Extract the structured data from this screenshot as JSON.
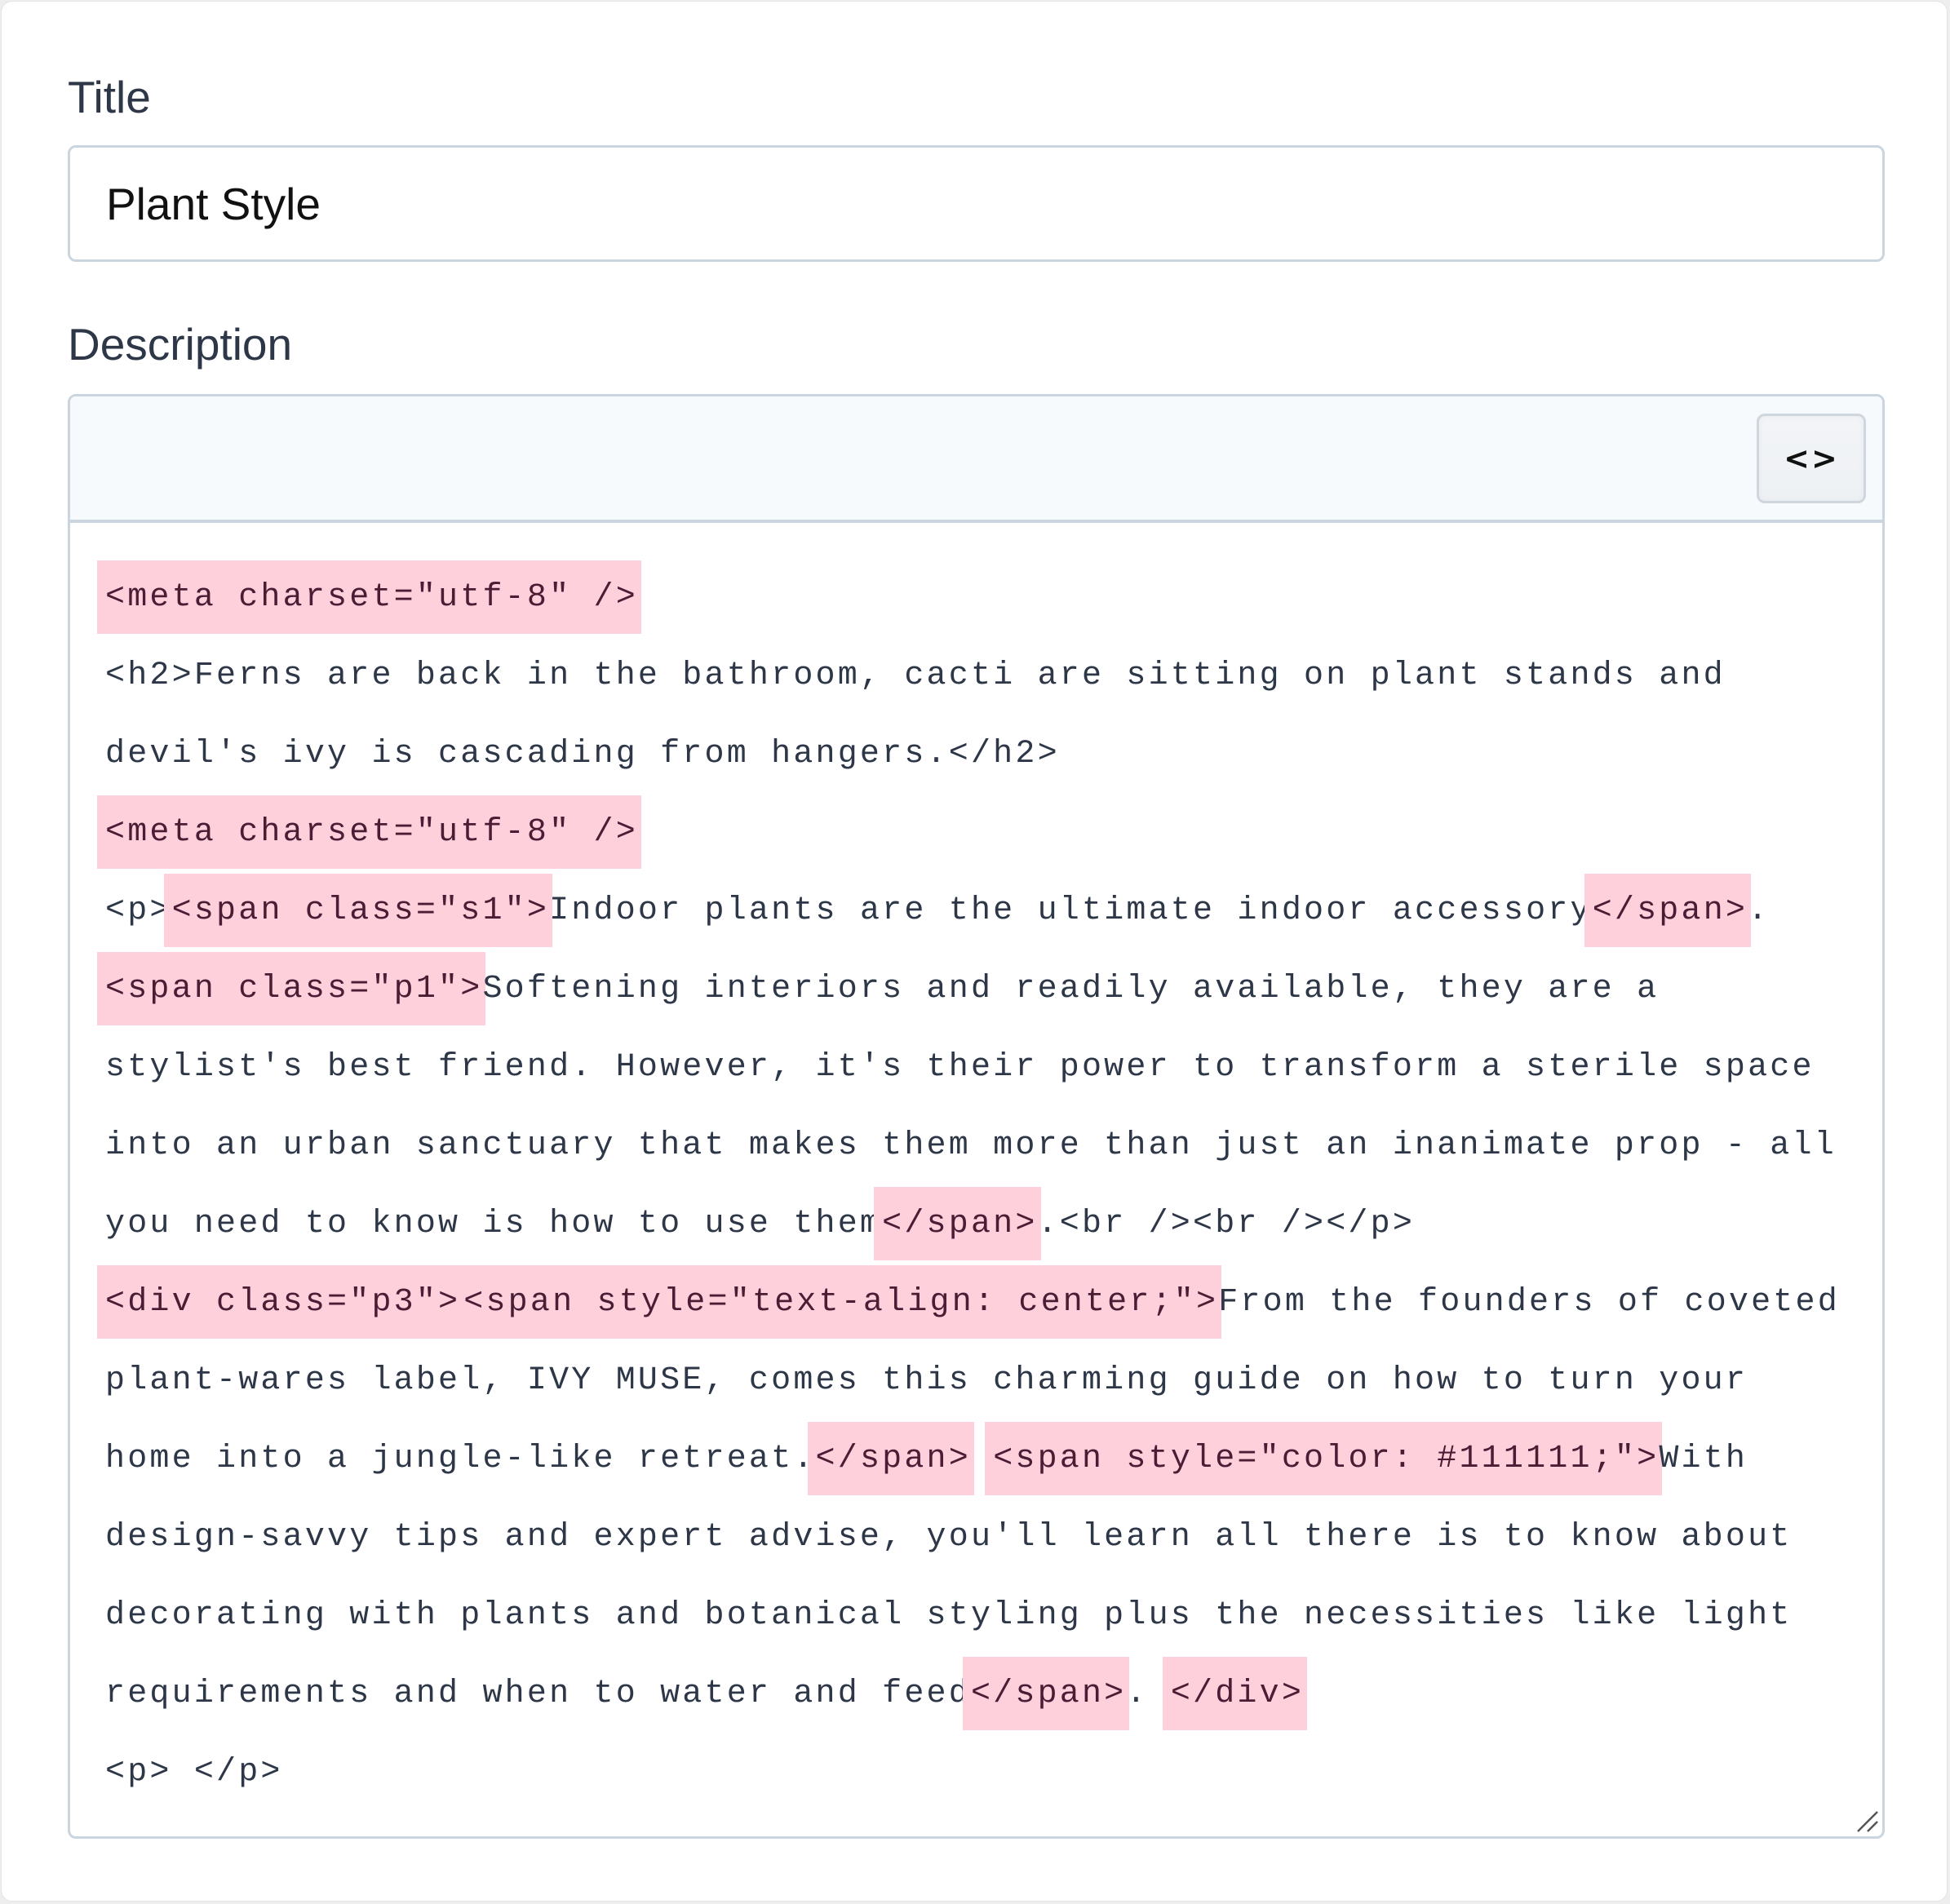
{
  "form": {
    "title_label": "Title",
    "title_value": "Plant Style",
    "description_label": "Description"
  },
  "editor": {
    "toolbar": {
      "source_toggle_label": "<>",
      "source_toggle_icon": "code-view-icon"
    },
    "highlight_color": "#fdd0dc",
    "text_color": "#2d3748",
    "lines": [
      [
        {
          "t": "<meta charset=\"utf-8\" />",
          "hl": true
        }
      ],
      [
        {
          "t": "<h2>Ferns are back in the bathroom, cacti are sitting on plant stands and",
          "hl": false
        }
      ],
      [
        {
          "t": "devil's ivy is cascading from hangers.</h2>",
          "hl": false
        }
      ],
      [
        {
          "t": "<meta charset=\"utf-8\" />",
          "hl": true
        }
      ],
      [
        {
          "t": "<p>",
          "hl": false
        },
        {
          "t": "<span class=\"s1\">",
          "hl": true
        },
        {
          "t": "Indoor plants are the ultimate indoor accessory",
          "hl": false
        },
        {
          "t": "</span>",
          "hl": true
        },
        {
          "t": ".",
          "hl": false
        }
      ],
      [
        {
          "t": "<span class=\"p1\">",
          "hl": true
        },
        {
          "t": "Softening interiors and readily available, they are a",
          "hl": false
        }
      ],
      [
        {
          "t": "stylist's best friend. However, it's their power to transform a sterile space",
          "hl": false
        }
      ],
      [
        {
          "t": "into an urban sanctuary that makes them more than just an inanimate prop - all",
          "hl": false
        }
      ],
      [
        {
          "t": "you need to know is how to use them",
          "hl": false
        },
        {
          "t": "</span>",
          "hl": true
        },
        {
          "t": ".<br /><br /></p>",
          "hl": false
        }
      ],
      [
        {
          "t": "<div class=\"p3\">",
          "hl": true
        },
        {
          "t": "<span style=\"text-align: center;\">",
          "hl": true
        },
        {
          "t": "From the founders of coveted",
          "hl": false
        }
      ],
      [
        {
          "t": "plant-wares label, IVY MUSE, comes this charming guide on how to turn your",
          "hl": false
        }
      ],
      [
        {
          "t": "home into a jungle-like retreat.",
          "hl": false
        },
        {
          "t": "</span>",
          "hl": true
        },
        {
          "t": " ",
          "hl": false
        },
        {
          "t": "<span style=\"color: #111111;\">",
          "hl": true
        },
        {
          "t": "With",
          "hl": false
        }
      ],
      [
        {
          "t": "design-savvy tips and expert advise, you'll learn all there is to know about",
          "hl": false
        }
      ],
      [
        {
          "t": "decorating with plants and botanical styling plus the necessities like light",
          "hl": false
        }
      ],
      [
        {
          "t": "requirements and when to water and feed",
          "hl": false
        },
        {
          "t": "</span>",
          "hl": true
        },
        {
          "t": ". ",
          "hl": false
        },
        {
          "t": "</div>",
          "hl": true
        }
      ],
      [
        {
          "t": "<p> </p>",
          "hl": false
        }
      ]
    ]
  }
}
